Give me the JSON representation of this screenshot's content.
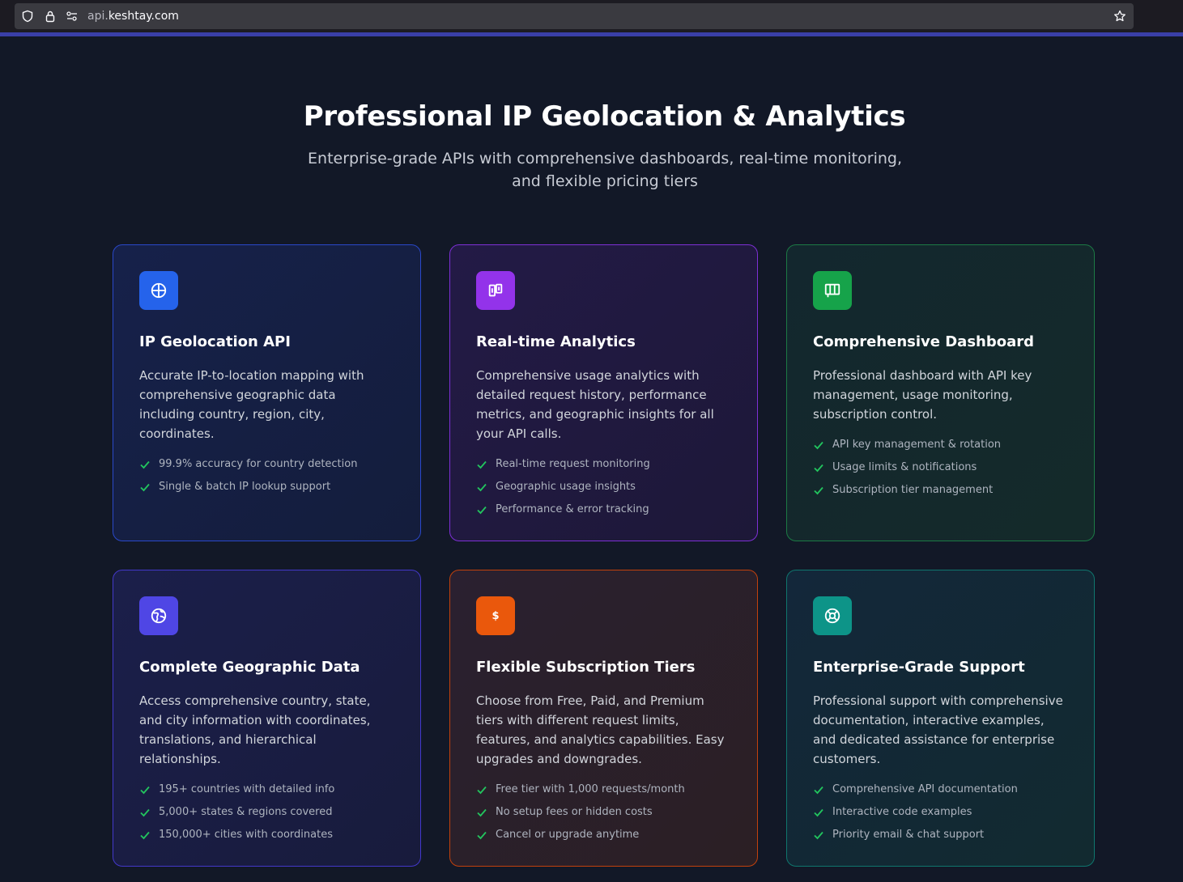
{
  "browser": {
    "url_dim": "api.",
    "url_main": "keshtay.com"
  },
  "hero": {
    "title": "Professional IP Geolocation & Analytics",
    "subtitle": "Enterprise-grade APIs with comprehensive dashboards, real-time monitoring, and flexible pricing tiers"
  },
  "colors": {
    "check": "#22c55e",
    "blue": "#2563eb",
    "purple": "#9333ea",
    "green": "#16a34a",
    "indigo": "#4f46e5",
    "orange": "#ea580c",
    "teal": "#0d9488"
  },
  "cards": [
    {
      "icon": "globe-icon",
      "title": "IP Geolocation API",
      "description": "Accurate IP-to-location mapping with comprehensive geographic data including country, region, city, coordinates.",
      "features": [
        "99.9% accuracy for country detection",
        "Single & batch IP lookup support"
      ]
    },
    {
      "icon": "analytics-icon",
      "title": "Real-time Analytics",
      "description": "Comprehensive usage analytics with detailed request history, performance metrics, and geographic insights for all your API calls.",
      "features": [
        "Real-time request monitoring",
        "Geographic usage insights",
        "Performance & error tracking"
      ]
    },
    {
      "icon": "dashboard-icon",
      "title": "Comprehensive Dashboard",
      "description": "Professional dashboard with API key management, usage monitoring, subscription control.",
      "features": [
        "API key management & rotation",
        "Usage limits & notifications",
        "Subscription tier management"
      ]
    },
    {
      "icon": "world-map-icon",
      "title": "Complete Geographic Data",
      "description": "Access comprehensive country, state, and city information with coordinates, translations, and hierarchical relationships.",
      "features": [
        "195+ countries with detailed info",
        "5,000+ states & regions covered",
        "150,000+ cities with coordinates"
      ]
    },
    {
      "icon": "dollar-icon",
      "badge_text": "$",
      "title": "Flexible Subscription Tiers",
      "description": "Choose from Free, Paid, and Premium tiers with different request limits, features, and analytics capabilities. Easy upgrades and downgrades.",
      "features": [
        "Free tier with 1,000 requests/month",
        "No setup fees or hidden costs",
        "Cancel or upgrade anytime"
      ]
    },
    {
      "icon": "support-lifebuoy-icon",
      "title": "Enterprise-Grade Support",
      "description": "Professional support with comprehensive documentation, interactive examples, and dedicated assistance for enterprise customers.",
      "features": [
        "Comprehensive API documentation",
        "Interactive code examples",
        "Priority email & chat support"
      ]
    }
  ]
}
